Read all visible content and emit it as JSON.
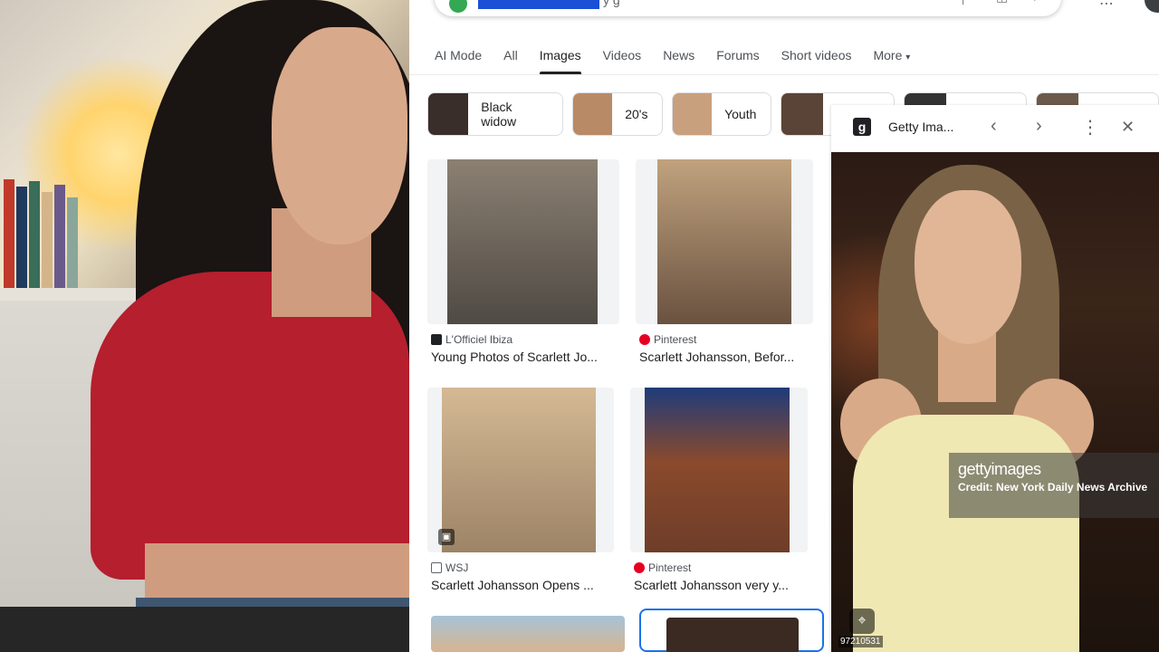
{
  "search": {
    "query_visible": "y        g"
  },
  "tabs": [
    {
      "label": "AI Mode"
    },
    {
      "label": "All"
    },
    {
      "label": "Images"
    },
    {
      "label": "Videos"
    },
    {
      "label": "News"
    },
    {
      "label": "Forums"
    },
    {
      "label": "Short videos"
    },
    {
      "label": "More"
    }
  ],
  "chips": [
    {
      "label": "Black widow",
      "color": "#3a2e2a"
    },
    {
      "label": "20's",
      "color": "#b98a66"
    },
    {
      "label": "Youth",
      "color": "#c9a07e"
    },
    {
      "label": "",
      "color": "#5a4437"
    },
    {
      "label": "",
      "color": "#333333"
    },
    {
      "label": "",
      "color": "#6b5a4c"
    }
  ],
  "results": [
    {
      "source": "L'Officiel Ibiza",
      "title": "Young Photos of Scarlett Jo...",
      "fav_color": "#202124",
      "img_color": "#8b8072"
    },
    {
      "source": "Pinterest",
      "title": "Scarlett Johansson, Befor...",
      "fav_color": "#e60023",
      "img_color": "#9a7b5e"
    },
    {
      "source": "WSJ",
      "title": "Scarlett Johansson Opens ...",
      "fav_color": "#5f6368",
      "img_color": "#b49a7a"
    },
    {
      "source": "Pinterest",
      "title": "Scarlett Johansson very y...",
      "fav_color": "#e60023",
      "img_color": "#6e3d29"
    },
    {
      "source": "",
      "title": "",
      "fav_color": "#e8a56f",
      "img_color": "#d7b48f"
    },
    {
      "source": "",
      "title": "",
      "fav_color": "#2d2420",
      "img_color": "#3a2a22"
    }
  ],
  "panel": {
    "source": "Getty Ima...",
    "logo": "g",
    "watermark_logo": "gettyimages",
    "watermark_credit": "Credit: New York Daily News Archive",
    "image_id": "97210531"
  },
  "icons": {
    "prev": "‹",
    "next": "›",
    "more": "⋮",
    "close": "✕",
    "lens": "⌖",
    "more_caret": "▾"
  }
}
